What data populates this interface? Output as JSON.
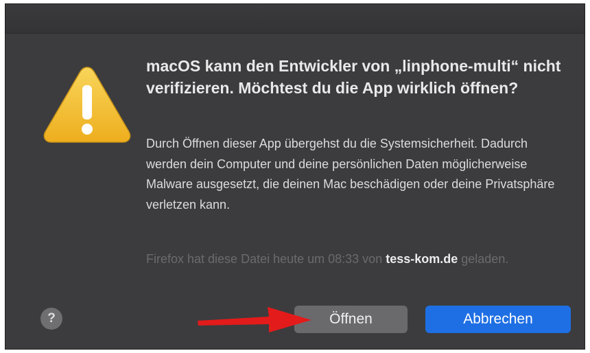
{
  "dialog": {
    "title": "macOS kann den Entwickler von „linphone-multi“ nicht verifizieren. Möchtest du die App wirklich öffnen?",
    "body": "Durch Öffnen dieser App übergehst du die Systemsicherheit. Dadurch werden dein Computer und deine persönlichen Daten möglicherweise Malware ausgesetzt, die deinen Mac beschädigen oder deine Privatsphäre verletzen kann.",
    "note_prefix": "Firefox hat diese Datei heute um 08:33 von ",
    "note_domain": "tess-kom.de",
    "note_suffix": " geladen.",
    "help_label": "?",
    "open_label": "Öffnen",
    "cancel_label": "Abbrechen"
  },
  "icons": {
    "warning": "warning-icon",
    "help": "help-icon",
    "annotation": "arrow-icon"
  },
  "colors": {
    "dialog_background": "#3c3c3e",
    "warning_yellow": "#f5c542",
    "cancel_blue": "#1e6fe3",
    "open_gray": "#6a6a6d",
    "annotation_red": "#e31b1b"
  }
}
